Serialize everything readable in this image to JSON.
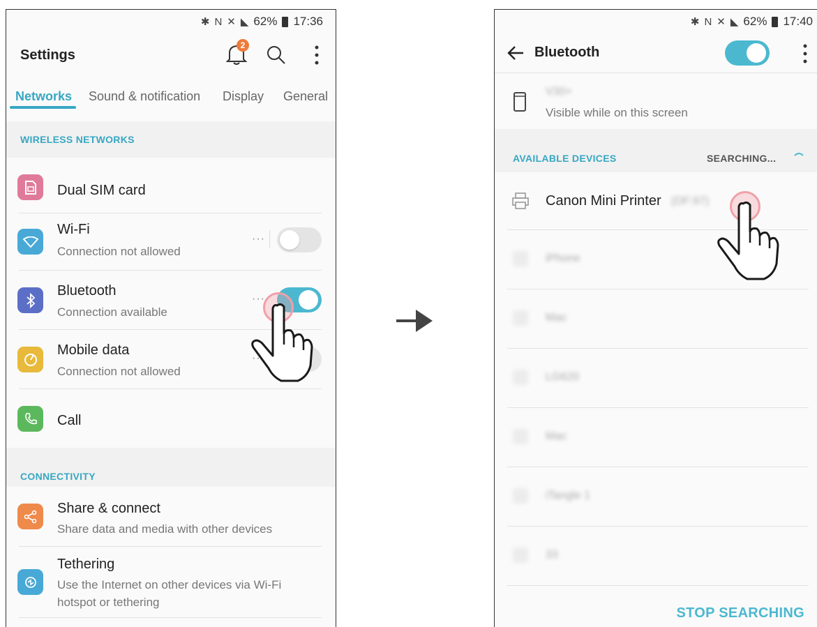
{
  "left": {
    "status": {
      "battery": "62%",
      "time": "17:36"
    },
    "title": "Settings",
    "notification_count": "2",
    "tabs": [
      "Networks",
      "Sound & notification",
      "Display",
      "General"
    ],
    "sections": {
      "wireless": "WIRELESS NETWORKS",
      "connectivity": "CONNECTIVITY"
    },
    "items": {
      "dual_sim": {
        "title": "Dual SIM card",
        "icon": "sim-icon",
        "color": "#e07a9a"
      },
      "wifi": {
        "title": "Wi-Fi",
        "sub": "Connection not allowed",
        "icon": "wifi-icon",
        "color": "#48a9d6",
        "toggle": "off"
      },
      "bluetooth": {
        "title": "Bluetooth",
        "sub": "Connection available",
        "icon": "bluetooth-icon",
        "color": "#5b6fc7",
        "toggle": "on"
      },
      "mobile_data": {
        "title": "Mobile data",
        "sub": "Connection not allowed",
        "icon": "mobile-data-icon",
        "color": "#e8b93a",
        "toggle": "off"
      },
      "call": {
        "title": "Call",
        "icon": "phone-icon",
        "color": "#5cb85c"
      },
      "share": {
        "title": "Share & connect",
        "sub": "Share data and media with other devices",
        "icon": "share-icon",
        "color": "#ee8a4a"
      },
      "tethering": {
        "title": "Tethering",
        "sub1": "Use the Internet on other devices via Wi-Fi",
        "sub2": "hotspot or tethering",
        "icon": "tethering-icon",
        "color": "#48a9d6"
      }
    }
  },
  "right": {
    "status": {
      "battery": "62%",
      "time": "17:40"
    },
    "title": "Bluetooth",
    "device_name": "V30+",
    "visible_text": "Visible while on this screen",
    "available_label": "AVAILABLE DEVICES",
    "searching_label": "SEARCHING...",
    "printer": {
      "name": "Canon Mini Printer",
      "suffix": "(DF:97)"
    },
    "blurred_devices": [
      "iPhone",
      "Mac",
      "LG620",
      "Mac",
      "iTangle 1",
      "33"
    ],
    "stop_button": "STOP SEARCHING"
  },
  "colors": {
    "accent": "#37a7c3",
    "toggle_on": "#4bb8d0",
    "badge": "#ee7a3a",
    "touch": "#f0a0a8"
  }
}
